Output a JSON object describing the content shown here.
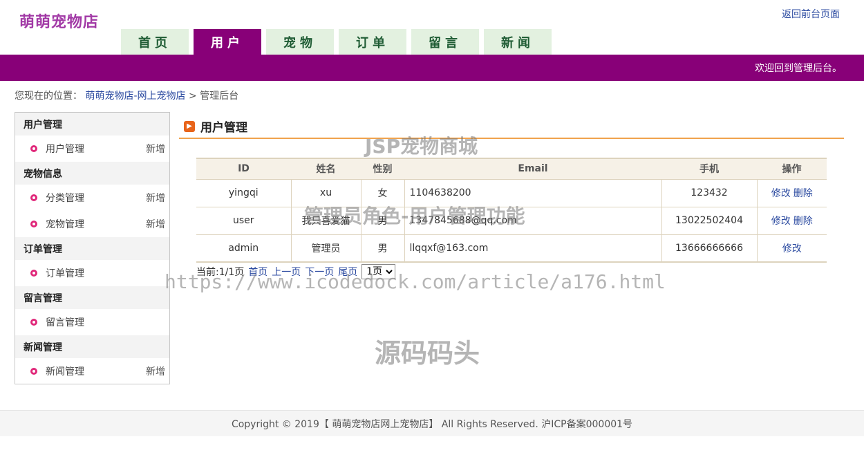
{
  "header": {
    "logo": "萌萌宠物店",
    "back_link": "返回前台页面",
    "welcome": "欢迎回到管理后台。"
  },
  "nav": {
    "tabs": [
      {
        "label": "首页",
        "active": false
      },
      {
        "label": "用户",
        "active": true
      },
      {
        "label": "宠物",
        "active": false
      },
      {
        "label": "订单",
        "active": false
      },
      {
        "label": "留言",
        "active": false
      },
      {
        "label": "新闻",
        "active": false
      }
    ]
  },
  "breadcrumb": {
    "prefix": "您现在的位置：",
    "link": "萌萌宠物店-网上宠物店",
    "separator": ">",
    "current": "管理后台"
  },
  "sidebar": {
    "groups": [
      {
        "title": "用户管理",
        "items": [
          {
            "label": "用户管理",
            "action": "新增"
          }
        ]
      },
      {
        "title": "宠物信息",
        "items": [
          {
            "label": "分类管理",
            "action": "新增"
          },
          {
            "label": "宠物管理",
            "action": "新增"
          }
        ]
      },
      {
        "title": "订单管理",
        "items": [
          {
            "label": "订单管理",
            "action": ""
          }
        ]
      },
      {
        "title": "留言管理",
        "items": [
          {
            "label": "留言管理",
            "action": ""
          }
        ]
      },
      {
        "title": "新闻管理",
        "items": [
          {
            "label": "新闻管理",
            "action": "新增"
          }
        ]
      }
    ]
  },
  "main": {
    "title": "用户管理",
    "title_icon": "arrow-right-icon",
    "table": {
      "headers": [
        "ID",
        "姓名",
        "性别",
        "Email",
        "手机",
        "操作"
      ],
      "rows": [
        {
          "id": "yingqi",
          "name": "xu",
          "gender": "女",
          "email": "1104638200",
          "phone": "123432",
          "edit": "修改",
          "delete": "删除"
        },
        {
          "id": "user",
          "name": "我只喜爱猫",
          "gender": "男",
          "email": "1347845688@qq.com",
          "phone": "13022502404",
          "edit": "修改",
          "delete": "删除"
        },
        {
          "id": "admin",
          "name": "管理员",
          "gender": "男",
          "email": "llqqxf@163.com",
          "phone": "13666666666",
          "edit": "修改",
          "delete": ""
        }
      ]
    },
    "pager": {
      "status": "当前:1/1页",
      "first": "首页",
      "prev": "上一页",
      "next": "下一页",
      "last": "尾页",
      "selected": "1页"
    }
  },
  "watermarks": {
    "line1": "JSP宠物商城",
    "line2": "管理员角色-用户管理功能",
    "line3": "https://www.icodedock.com/article/a176.html",
    "line4": "源码码头"
  },
  "footer": {
    "text": "Copyright © 2019【 萌萌宠物店网上宠物店】 All Rights Reserved. 沪ICP备案000001号"
  },
  "colors": {
    "brand_purple": "#880078",
    "logo_purple": "#a23aa6",
    "tab_green_bg": "#e3f1e0",
    "accent_orange": "#f0a34d",
    "link_blue": "#2b4aa0",
    "bullet_pink": "#e0287a"
  }
}
